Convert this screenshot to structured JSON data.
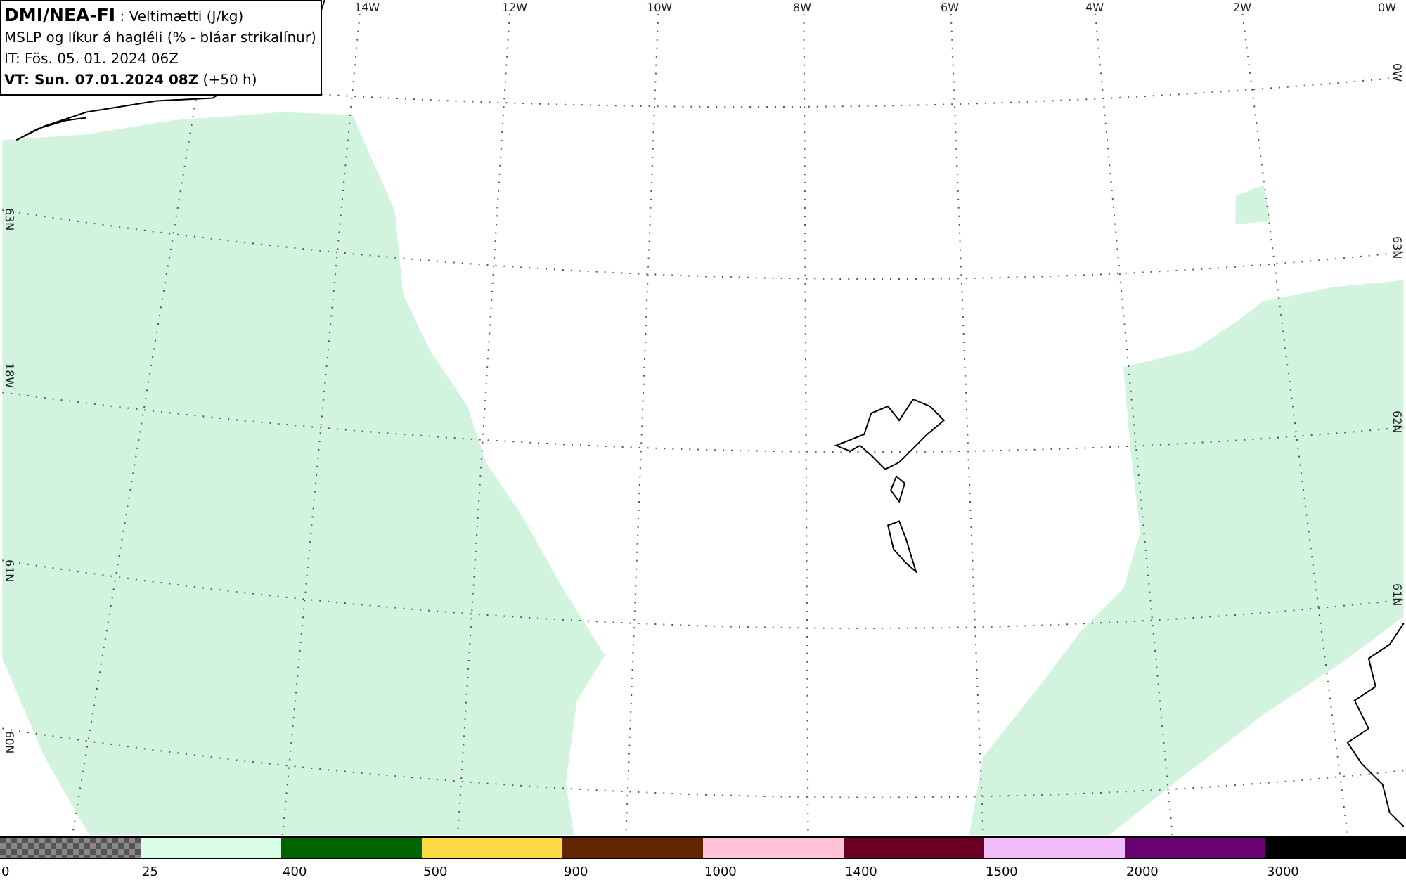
{
  "info_box": {
    "lines": [
      "**DMI/NEA-FI** : Veltimætti (J/kg)",
      "MSLP og líkur á hagléli (% - bláar strikalínur)",
      "IT: Fös. 05. 01. 2024 06Z",
      "**VT: Sun. 07.01.2024 08Z** (+50 h)"
    ]
  },
  "map": {
    "top_labels": [
      "14W",
      "12W",
      "10W",
      "8W",
      "6W",
      "4W",
      "2W",
      "0W"
    ],
    "left_labels": [
      "63N",
      "18W",
      "61N",
      "60N"
    ],
    "right_labels": [
      "0W",
      "63N",
      "62N",
      "61N"
    ]
  },
  "legend": {
    "segments": [
      {
        "kind": "checker",
        "color": "#555555",
        "label": "0"
      },
      {
        "kind": "solid",
        "color": "#d9fde6",
        "label": "25"
      },
      {
        "kind": "solid",
        "color": "#006400",
        "label": "400"
      },
      {
        "kind": "solid",
        "color": "#fcdc46",
        "label": "500"
      },
      {
        "kind": "solid",
        "color": "#652400",
        "label": "900"
      },
      {
        "kind": "solid",
        "color": "#ffc2d8",
        "label": "1000"
      },
      {
        "kind": "solid",
        "color": "#6b0026",
        "label": "1400"
      },
      {
        "kind": "solid",
        "color": "#f3bdfb",
        "label": "1500"
      },
      {
        "kind": "solid",
        "color": "#6b0070",
        "label": "2000"
      },
      {
        "kind": "solid",
        "color": "#000000",
        "label": "3000"
      }
    ]
  }
}
